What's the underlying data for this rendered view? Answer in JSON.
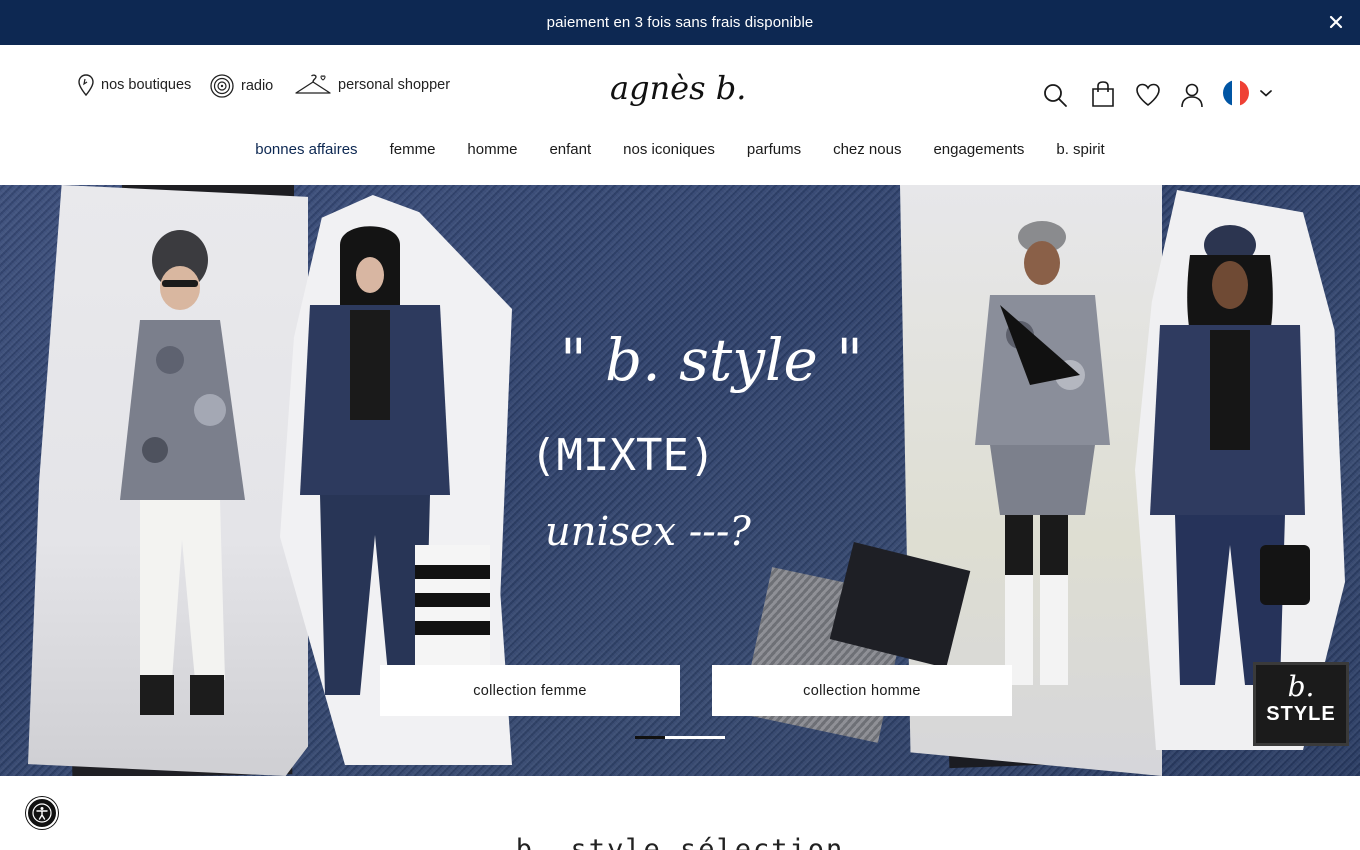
{
  "promo": {
    "text": "paiement en 3 fois sans frais disponible",
    "close_icon": "close-icon"
  },
  "header": {
    "utility_links": [
      {
        "label": "nos boutiques",
        "icon": "location-pin-icon"
      },
      {
        "label": "radio",
        "icon": "radio-spiral-icon"
      },
      {
        "label": "personal shopper",
        "icon": "hanger-icon"
      }
    ],
    "logo_text": "agnès b.",
    "actions": [
      "search-icon",
      "bag-icon",
      "heart-icon",
      "account-icon"
    ],
    "language": {
      "country": "FR",
      "flag_colors": [
        "#0055a4",
        "#ffffff",
        "#ef4135"
      ]
    }
  },
  "nav": {
    "items": [
      "bonnes affaires",
      "femme",
      "homme",
      "enfant",
      "nos iconiques",
      "parfums",
      "chez nous",
      "engagements",
      "b. spirit"
    ],
    "active_index": 0
  },
  "hero": {
    "handwriting": {
      "line1": "\" b. style \"",
      "line2": "(MIXTE)",
      "line3": "unisex ---?"
    },
    "buttons": {
      "left": "collection femme",
      "right": "collection homme"
    },
    "slides": {
      "count": 2,
      "active": 0
    },
    "badge": {
      "top": "b.",
      "bottom": "STYLE"
    }
  },
  "section": {
    "title": "b. style sélection"
  },
  "colors": {
    "brand_navy": "#0d2852",
    "denim": "#2e416c"
  }
}
